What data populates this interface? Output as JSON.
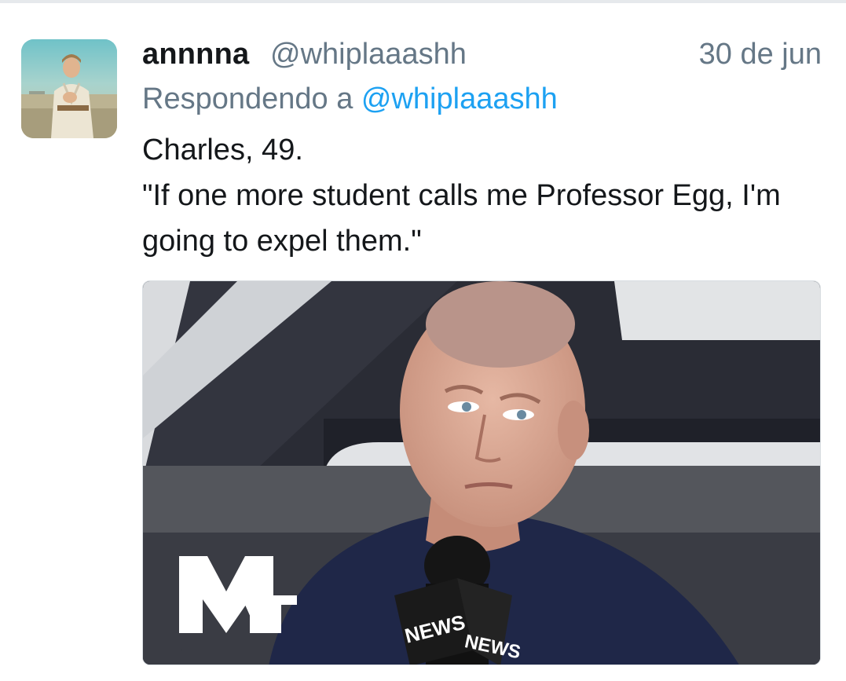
{
  "tweet": {
    "display_name": "annnna",
    "handle": "@whiplaaashh",
    "timestamp": "30 de jun",
    "reply_prefix": "Respondendo a ",
    "reply_to": "@whiplaaashh",
    "text_lines": [
      "Charles, 49.",
      "\"If one more student calls me Professor Egg, I'm going to expel them.\""
    ],
    "media": {
      "logo_text": "MTV",
      "mic_badge_text": "NEWS"
    }
  },
  "icons": {
    "avatar": "user-avatar",
    "media": "video-thumbnail"
  },
  "colors": {
    "name": "#14171a",
    "secondary": "#657786",
    "link": "#1da1f2",
    "divider": "#e6e9ec"
  }
}
